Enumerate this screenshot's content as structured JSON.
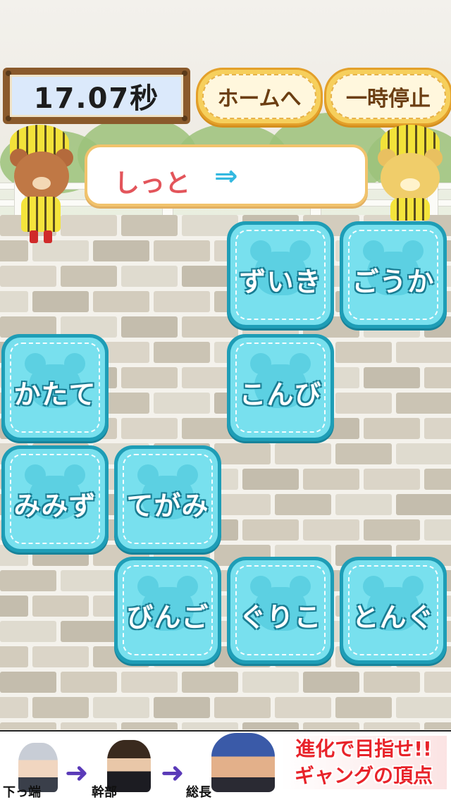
{
  "header": {
    "timer": "17.07秒",
    "home_button": "ホームへ",
    "pause_button": "一時停止"
  },
  "hint": {
    "word": "しっと",
    "arrow": "⇒"
  },
  "tiles": [
    "ずいき",
    "ごうか",
    "かたて",
    "こんび",
    "みみず",
    "てがみ",
    "びんご",
    "ぐりこ",
    "とんぐ"
  ],
  "ad": {
    "rank1": "下っ端",
    "rank2": "幹部",
    "rank3": "総長",
    "title_line1": "進化で目指せ!!",
    "title_line2": "ギャングの頂点"
  }
}
